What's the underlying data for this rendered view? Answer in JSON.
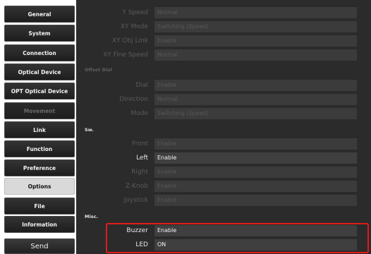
{
  "sidebar": {
    "items": [
      {
        "label": "General"
      },
      {
        "label": "System"
      },
      {
        "label": "Connection"
      },
      {
        "label": "Optical Device"
      },
      {
        "label": "OPT Optical Device"
      },
      {
        "label": "Movement"
      },
      {
        "label": "Link"
      },
      {
        "label": "Function"
      },
      {
        "label": "Preference"
      },
      {
        "label": "Options"
      },
      {
        "label": "File"
      },
      {
        "label": "Information"
      }
    ],
    "send_label": "Send"
  },
  "movement_rows": [
    {
      "label": "Y Speed",
      "value": "Normal"
    },
    {
      "label": "XY Mode",
      "value": "Switching (Speed)"
    },
    {
      "label": "XY Obj Link",
      "value": "Enable"
    },
    {
      "label": "XY Fine Speed",
      "value": "Normal"
    }
  ],
  "offset_dial": {
    "title": "Offset Dial",
    "rows": [
      {
        "label": "Dial",
        "value": "Enable"
      },
      {
        "label": "Direction",
        "value": "Normal"
      },
      {
        "label": "Mode",
        "value": "Switching (Speed)"
      }
    ]
  },
  "sw": {
    "title": "Sw.",
    "rows": [
      {
        "label": "Front",
        "value": "Enable"
      },
      {
        "label": "Left",
        "value": "Enable"
      },
      {
        "label": "Right",
        "value": "Enable"
      },
      {
        "label": "Z-Knob",
        "value": "Enable"
      },
      {
        "label": "Joystick",
        "value": "Enable"
      }
    ]
  },
  "misc": {
    "title": "Misc.",
    "rows": [
      {
        "label": "Buzzer",
        "value": "Enable"
      },
      {
        "label": "LED",
        "value": "ON"
      }
    ]
  },
  "colors": {
    "highlight": "#e11b1b",
    "panel_bg": "#2b2b2b",
    "selected_nav": "#d9d9d9"
  }
}
